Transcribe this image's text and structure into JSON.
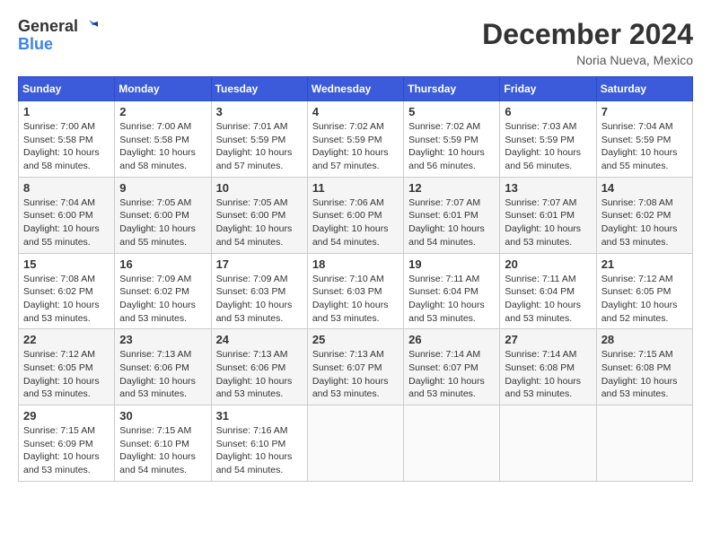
{
  "logo": {
    "text_general": "General",
    "text_blue": "Blue"
  },
  "title": "December 2024",
  "location": "Noria Nueva, Mexico",
  "days_of_week": [
    "Sunday",
    "Monday",
    "Tuesday",
    "Wednesday",
    "Thursday",
    "Friday",
    "Saturday"
  ],
  "weeks": [
    [
      {
        "day": "1",
        "info": "Sunrise: 7:00 AM\nSunset: 5:58 PM\nDaylight: 10 hours\nand 58 minutes."
      },
      {
        "day": "2",
        "info": "Sunrise: 7:00 AM\nSunset: 5:58 PM\nDaylight: 10 hours\nand 58 minutes."
      },
      {
        "day": "3",
        "info": "Sunrise: 7:01 AM\nSunset: 5:59 PM\nDaylight: 10 hours\nand 57 minutes."
      },
      {
        "day": "4",
        "info": "Sunrise: 7:02 AM\nSunset: 5:59 PM\nDaylight: 10 hours\nand 57 minutes."
      },
      {
        "day": "5",
        "info": "Sunrise: 7:02 AM\nSunset: 5:59 PM\nDaylight: 10 hours\nand 56 minutes."
      },
      {
        "day": "6",
        "info": "Sunrise: 7:03 AM\nSunset: 5:59 PM\nDaylight: 10 hours\nand 56 minutes."
      },
      {
        "day": "7",
        "info": "Sunrise: 7:04 AM\nSunset: 5:59 PM\nDaylight: 10 hours\nand 55 minutes."
      }
    ],
    [
      {
        "day": "8",
        "info": "Sunrise: 7:04 AM\nSunset: 6:00 PM\nDaylight: 10 hours\nand 55 minutes."
      },
      {
        "day": "9",
        "info": "Sunrise: 7:05 AM\nSunset: 6:00 PM\nDaylight: 10 hours\nand 55 minutes."
      },
      {
        "day": "10",
        "info": "Sunrise: 7:05 AM\nSunset: 6:00 PM\nDaylight: 10 hours\nand 54 minutes."
      },
      {
        "day": "11",
        "info": "Sunrise: 7:06 AM\nSunset: 6:00 PM\nDaylight: 10 hours\nand 54 minutes."
      },
      {
        "day": "12",
        "info": "Sunrise: 7:07 AM\nSunset: 6:01 PM\nDaylight: 10 hours\nand 54 minutes."
      },
      {
        "day": "13",
        "info": "Sunrise: 7:07 AM\nSunset: 6:01 PM\nDaylight: 10 hours\nand 53 minutes."
      },
      {
        "day": "14",
        "info": "Sunrise: 7:08 AM\nSunset: 6:02 PM\nDaylight: 10 hours\nand 53 minutes."
      }
    ],
    [
      {
        "day": "15",
        "info": "Sunrise: 7:08 AM\nSunset: 6:02 PM\nDaylight: 10 hours\nand 53 minutes."
      },
      {
        "day": "16",
        "info": "Sunrise: 7:09 AM\nSunset: 6:02 PM\nDaylight: 10 hours\nand 53 minutes."
      },
      {
        "day": "17",
        "info": "Sunrise: 7:09 AM\nSunset: 6:03 PM\nDaylight: 10 hours\nand 53 minutes."
      },
      {
        "day": "18",
        "info": "Sunrise: 7:10 AM\nSunset: 6:03 PM\nDaylight: 10 hours\nand 53 minutes."
      },
      {
        "day": "19",
        "info": "Sunrise: 7:11 AM\nSunset: 6:04 PM\nDaylight: 10 hours\nand 53 minutes."
      },
      {
        "day": "20",
        "info": "Sunrise: 7:11 AM\nSunset: 6:04 PM\nDaylight: 10 hours\nand 53 minutes."
      },
      {
        "day": "21",
        "info": "Sunrise: 7:12 AM\nSunset: 6:05 PM\nDaylight: 10 hours\nand 52 minutes."
      }
    ],
    [
      {
        "day": "22",
        "info": "Sunrise: 7:12 AM\nSunset: 6:05 PM\nDaylight: 10 hours\nand 53 minutes."
      },
      {
        "day": "23",
        "info": "Sunrise: 7:13 AM\nSunset: 6:06 PM\nDaylight: 10 hours\nand 53 minutes."
      },
      {
        "day": "24",
        "info": "Sunrise: 7:13 AM\nSunset: 6:06 PM\nDaylight: 10 hours\nand 53 minutes."
      },
      {
        "day": "25",
        "info": "Sunrise: 7:13 AM\nSunset: 6:07 PM\nDaylight: 10 hours\nand 53 minutes."
      },
      {
        "day": "26",
        "info": "Sunrise: 7:14 AM\nSunset: 6:07 PM\nDaylight: 10 hours\nand 53 minutes."
      },
      {
        "day": "27",
        "info": "Sunrise: 7:14 AM\nSunset: 6:08 PM\nDaylight: 10 hours\nand 53 minutes."
      },
      {
        "day": "28",
        "info": "Sunrise: 7:15 AM\nSunset: 6:08 PM\nDaylight: 10 hours\nand 53 minutes."
      }
    ],
    [
      {
        "day": "29",
        "info": "Sunrise: 7:15 AM\nSunset: 6:09 PM\nDaylight: 10 hours\nand 53 minutes."
      },
      {
        "day": "30",
        "info": "Sunrise: 7:15 AM\nSunset: 6:10 PM\nDaylight: 10 hours\nand 54 minutes."
      },
      {
        "day": "31",
        "info": "Sunrise: 7:16 AM\nSunset: 6:10 PM\nDaylight: 10 hours\nand 54 minutes."
      },
      {
        "day": "",
        "info": ""
      },
      {
        "day": "",
        "info": ""
      },
      {
        "day": "",
        "info": ""
      },
      {
        "day": "",
        "info": ""
      }
    ]
  ]
}
